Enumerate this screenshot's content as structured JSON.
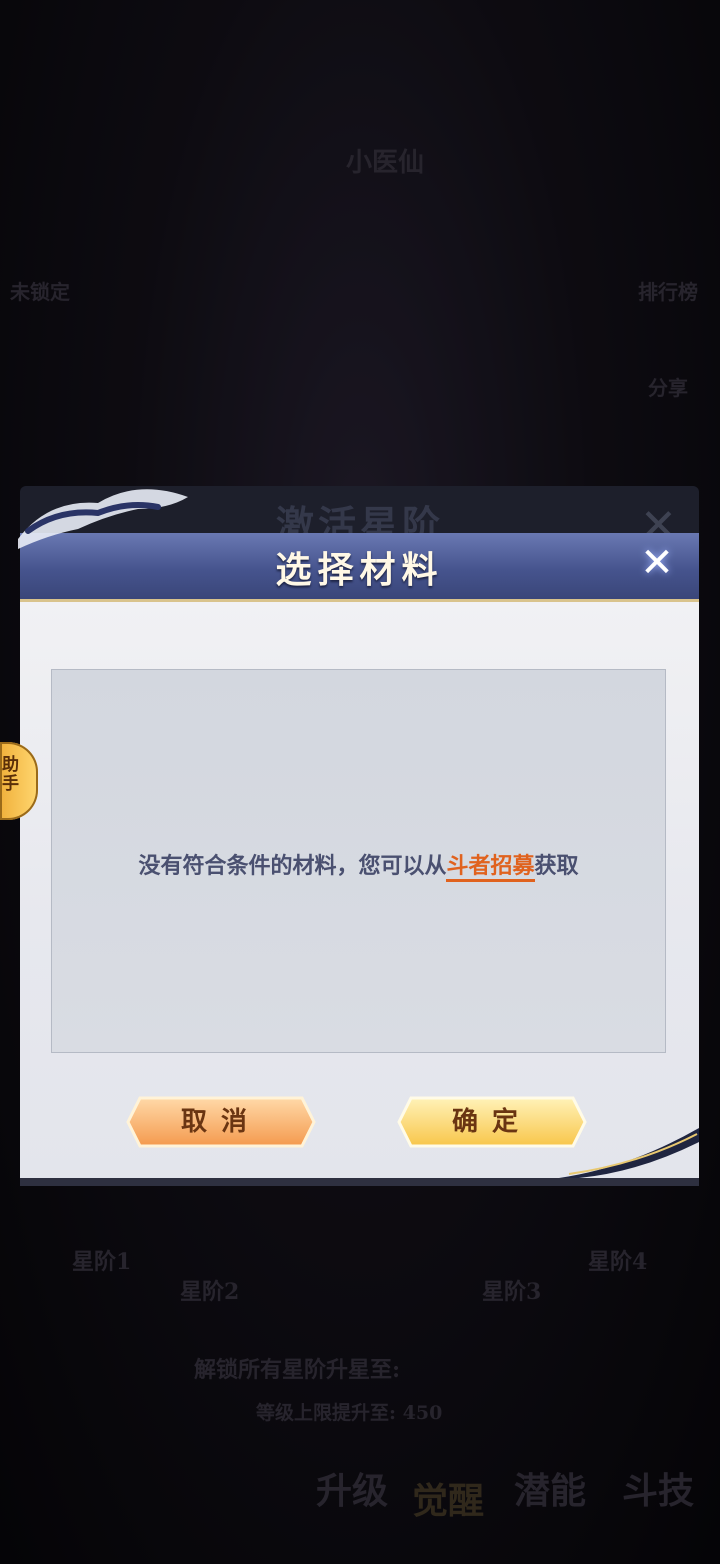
{
  "background": {
    "hero_name": "小医仙",
    "locked_label": "未锁定",
    "rank_label": "排行榜",
    "share_label": "分享",
    "star_stages": [
      "星阶1",
      "星阶2",
      "星阶3",
      "星阶4"
    ],
    "unlock_text": "解锁所有星阶升星至:",
    "level_limit_text": "等级上限提升至: 450",
    "bottom_tabs": [
      "升级",
      "觉醒",
      "潜能",
      "斗技"
    ]
  },
  "back_dialog": {
    "title": "激活星阶"
  },
  "dialog": {
    "title": "选择材料",
    "message_prefix": "没有符合条件的材料，您可以从",
    "message_link": "斗者招募",
    "message_suffix": "获取",
    "cancel_label": "取消",
    "confirm_label": "确定"
  },
  "helper_tab": {
    "label": "助手"
  },
  "colors": {
    "header": "#46548e",
    "link": "#e0621e",
    "cancel_button": "#f7a864",
    "confirm_button": "#ffd56b"
  }
}
